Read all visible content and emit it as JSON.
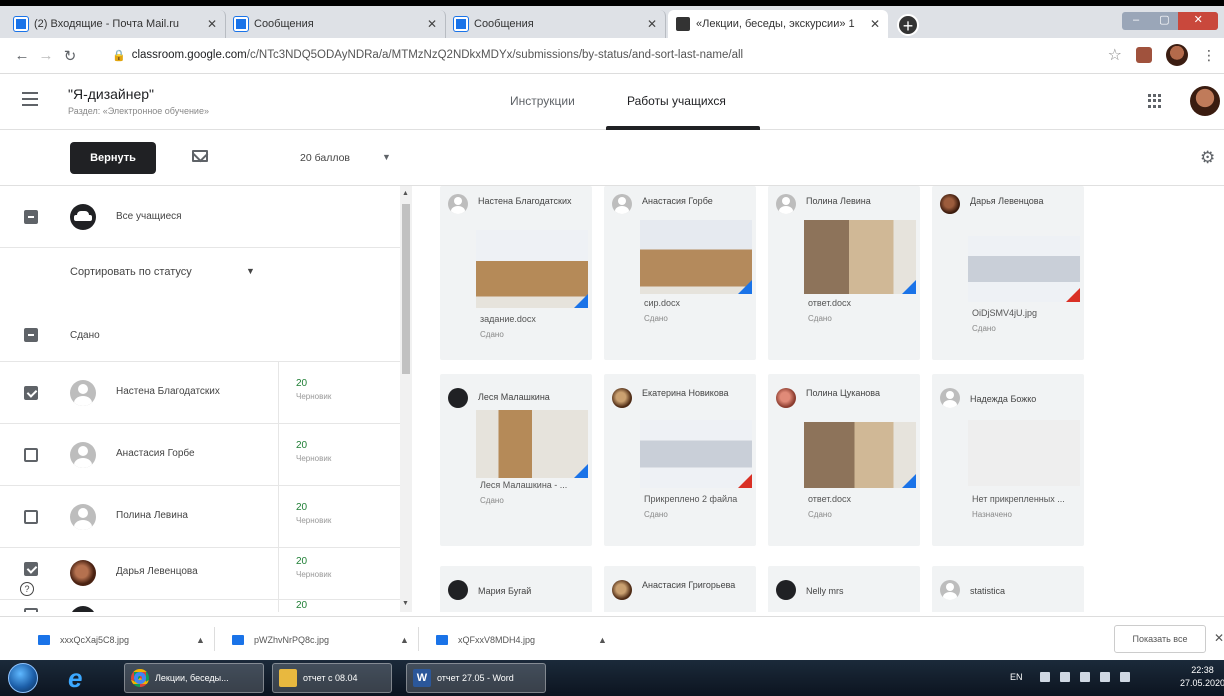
{
  "browser": {
    "tabs": [
      {
        "title": "(2) Входящие - Почта Mail.ru",
        "close": "✕"
      },
      {
        "title": "Сообщения",
        "close": "✕"
      },
      {
        "title": "Сообщения",
        "close": "✕"
      },
      {
        "title": "«Лекции, беседы, экскурсии» 1",
        "close": "✕"
      }
    ],
    "new_tab": "+",
    "url_host": "classroom.google.com",
    "url_path": "/c/NTc3NDQ5ODAyNDRa/a/MTMzNzQ2NDkxMDYx/submissions/by-status/and-sort-last-name/all",
    "window_controls": [
      "–",
      "▢",
      "✕"
    ]
  },
  "header": {
    "course_title": "\"Я-дизайнер\"",
    "course_subtitle": "Раздел: «Электронное обучение»",
    "tabs": [
      "Инструкции",
      "Работы учащихся"
    ]
  },
  "toolbar": {
    "return_label": "Вернуть",
    "points_label": "20 баллов"
  },
  "left": {
    "all_students": "Все учащиеся",
    "sort_label": "Сортировать по статусу",
    "group_label": "Сдано",
    "students": [
      {
        "name": "Настена Благодатских",
        "score": "20",
        "status": "Черновик",
        "checked": true
      },
      {
        "name": "Анастасия Горбе",
        "score": "20",
        "status": "Черновик",
        "checked": false
      },
      {
        "name": "Полина Левина",
        "score": "20",
        "status": "Черновик",
        "checked": false
      },
      {
        "name": "Дарья Левенцова",
        "score": "20",
        "status": "Черновик",
        "checked": true
      },
      {
        "name": "",
        "score": "20",
        "status": "",
        "checked": false
      }
    ]
  },
  "cards": [
    {
      "name": "Настена Благодатских",
      "file": "задание.docx",
      "status": "Сдано"
    },
    {
      "name": "Анастасия Горбе",
      "file": "сир.docx",
      "status": "Сдано"
    },
    {
      "name": "Полина Левина",
      "file": "ответ.docx",
      "status": "Сдано"
    },
    {
      "name": "Дарья Левенцова",
      "file": "OiDjSMV4jU.jpg",
      "status": "Сдано"
    },
    {
      "name": "Леся Малашкина",
      "file": "Леся Малашкина - ...",
      "status": "Сдано"
    },
    {
      "name": "Екатерина Новикова",
      "file": "Прикреплено 2 файла",
      "status": "Сдано"
    },
    {
      "name": "Полина Цуканова",
      "file": "ответ.docx",
      "status": "Сдано"
    },
    {
      "name": "Надежда Божко",
      "file": "Нет прикрепленных ...",
      "status": "Назначено"
    },
    {
      "name": "Мария Бугай",
      "file": "",
      "status": ""
    },
    {
      "name": "Анастасия Григорьева",
      "file": "",
      "status": ""
    },
    {
      "name": "Nelly mrs",
      "file": "",
      "status": ""
    },
    {
      "name": "statistica",
      "file": "",
      "status": ""
    }
  ],
  "downloads": {
    "items": [
      "xxxQcXaj5C8.jpg",
      "pWZhvNrPQ8c.jpg",
      "xQFxxV8MDH4.jpg"
    ],
    "show_all": "Показать все",
    "close": "✕"
  },
  "taskbar": {
    "items": [
      "Лекции, беседы...",
      "отчет с 08.04",
      "отчет 27.05 - Word"
    ],
    "lang": "EN",
    "time": "22:38",
    "date": "27.05.2020"
  }
}
